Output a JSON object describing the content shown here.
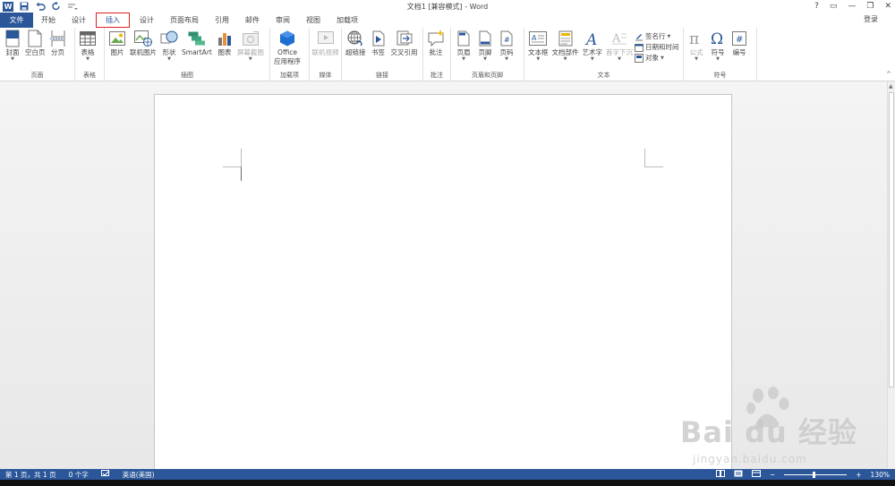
{
  "window": {
    "title": "文档1 [兼容模式] - Word",
    "controls": [
      "?",
      "▭",
      "—",
      "❐",
      "✕"
    ]
  },
  "tabs": {
    "file": "文件",
    "items": [
      "开始",
      "设计",
      "插入",
      "设计",
      "页面布局",
      "引用",
      "邮件",
      "审阅",
      "视图",
      "加载项"
    ],
    "active": "插入",
    "login": "登录"
  },
  "ribbon": {
    "pages": {
      "name": "页面",
      "cover": "封面",
      "blank": "空白页",
      "break": "分页"
    },
    "tables": {
      "name": "表格",
      "table": "表格"
    },
    "illustrations": {
      "name": "插图",
      "picture": "图片",
      "online_picture": "联机图片",
      "shapes": "形状",
      "smartart": "SmartArt",
      "chart": "图表",
      "screenshot": "屏幕截图"
    },
    "addins": {
      "name": "加载项",
      "office_line1": "Office",
      "office_line2": "应用程序"
    },
    "media": {
      "name": "媒体",
      "online_video": "联机视频"
    },
    "links": {
      "name": "链接",
      "hyperlink": "超链接",
      "bookmark": "书签",
      "crossref": "交叉引用"
    },
    "comments": {
      "name": "批注",
      "comment": "批注"
    },
    "headerfooter": {
      "name": "页眉和页脚",
      "header": "页眉",
      "footer": "页脚",
      "pagenum": "页码"
    },
    "text": {
      "name": "文本",
      "textbox": "文本框",
      "quickparts": "文档部件",
      "wordart": "艺术字",
      "dropcap": "首字下沉",
      "signature": "签名行",
      "datetime": "日期和时间",
      "object": "对象"
    },
    "symbols": {
      "name": "符号",
      "equation": "公式",
      "symbol": "符号",
      "number": "编号"
    }
  },
  "status": {
    "page": "第 1 页，共 1 页",
    "words": "0 个字",
    "language": "英语(美国)",
    "zoom": "130%"
  },
  "watermark": {
    "sub": "jingyan.baidu.com"
  },
  "colors": {
    "accent": "#2b579a",
    "highlight": "#e02020"
  }
}
